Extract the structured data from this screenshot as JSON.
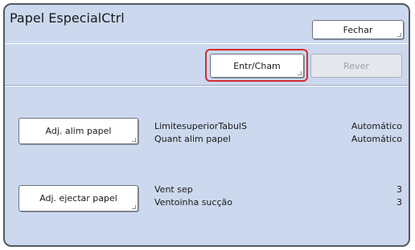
{
  "header": {
    "title": "Papel EspecialCtrl",
    "close_label": "Fechar"
  },
  "toolbar": {
    "enter_call_label": "Entr/Cham",
    "review_label": "Rever"
  },
  "feed_section": {
    "button_label": "Adj. alim papel",
    "rows": [
      {
        "label": "LimitesuperiorTabulS",
        "value": "Automático"
      },
      {
        "label": "Quant alim papel",
        "value": "Automático"
      }
    ]
  },
  "eject_section": {
    "button_label": "Adj. ejectar papel",
    "rows": [
      {
        "label": "Vent sep",
        "value": "3"
      },
      {
        "label": "Ventoinha sucção",
        "value": "3"
      }
    ]
  },
  "colors": {
    "panel_bg": "#cbd8ee",
    "highlight": "#d52a30",
    "border": "#54595f"
  }
}
